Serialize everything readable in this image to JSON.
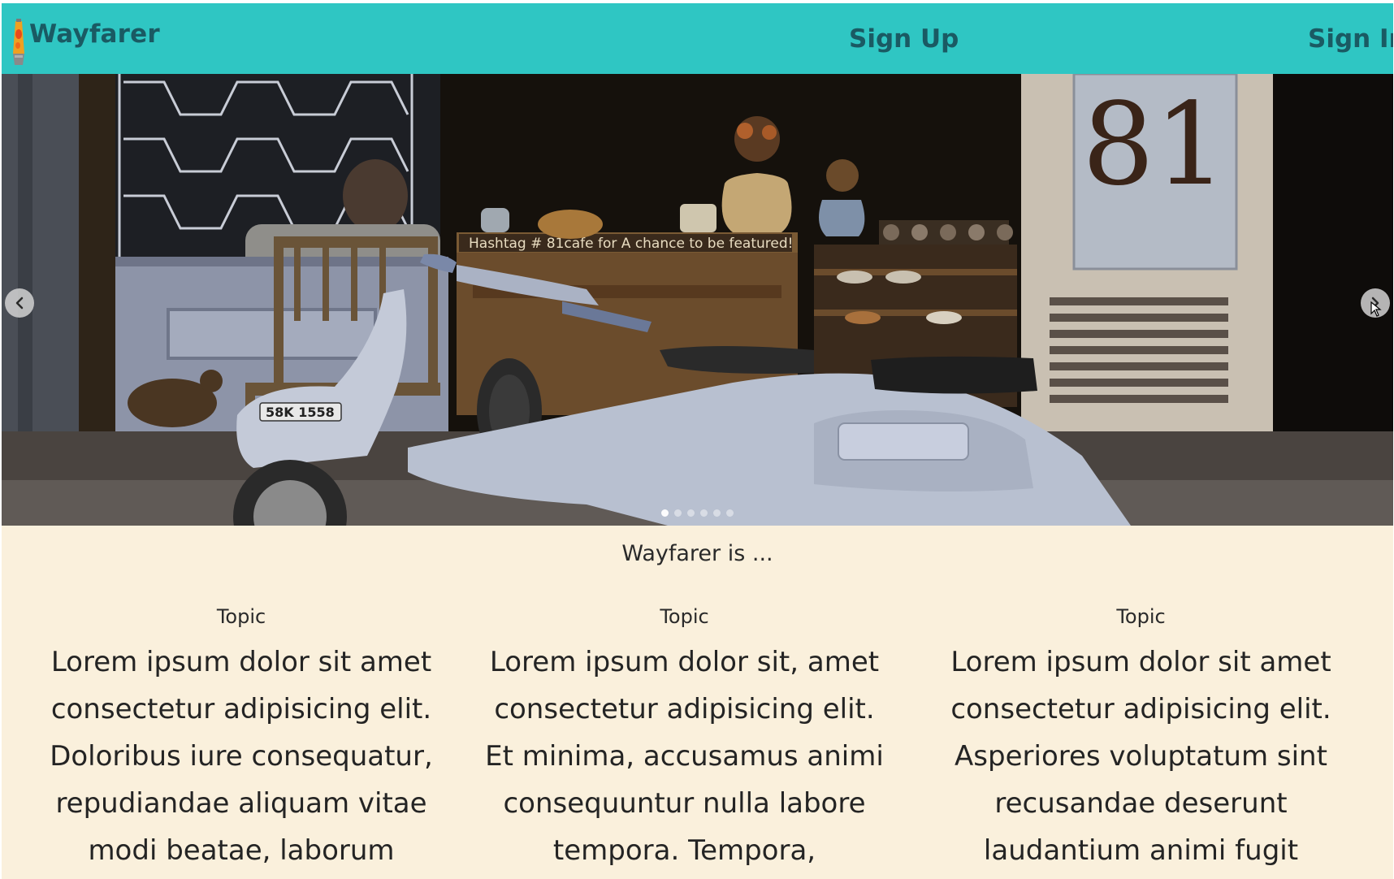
{
  "navbar": {
    "brand": "Wayfarer",
    "signup_label": "Sign Up",
    "signin_label": "Sign In",
    "background_color": "#2fc6c3",
    "text_color": "#1a5a63"
  },
  "carousel": {
    "slide_text": {
      "door_number": "81",
      "chalkboard": "Hashtag # 81cafe for A chance to be featured!",
      "license_plate": "58K 1558"
    },
    "prev_icon": "chevron-left-icon",
    "next_icon": "chevron-right-icon",
    "slide_count": 6,
    "active_slide": 1
  },
  "content": {
    "intro": "Wayfarer is ...",
    "topics": [
      {
        "title": "Topic",
        "body": "Lorem ipsum dolor sit amet consectetur adipisicing elit. Doloribus iure consequatur, repudiandae aliquam vitae modi beatae, laborum"
      },
      {
        "title": "Topic",
        "body": "Lorem ipsum dolor sit, amet consectetur adipisicing elit. Et minima, accusamus animi consequuntur nulla labore tempora. Tempora,"
      },
      {
        "title": "Topic",
        "body": "Lorem ipsum dolor sit amet consectetur adipisicing elit. Asperiores voluptatum sint recusandae deserunt laudantium animi fugit"
      }
    ]
  },
  "colors": {
    "page_background": "#faf0dc",
    "accent": "#2fc6c3"
  }
}
